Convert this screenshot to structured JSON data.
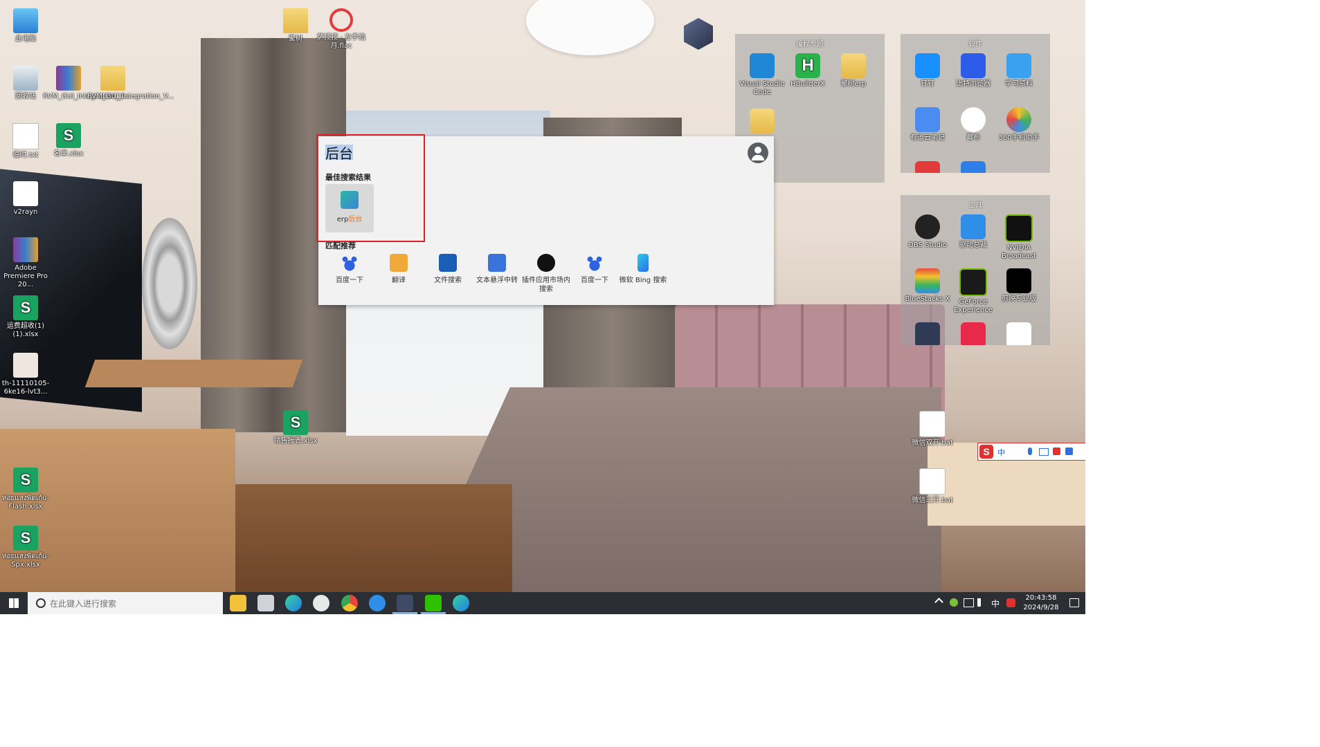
{
  "desktop_icons": [
    {
      "label": "此电脑"
    },
    {
      "label": "回收站"
    },
    {
      "label": "RVM_GUI_Integration_V..."
    },
    {
      "label": "RVM_GUI_Integration_V..."
    },
    {
      "label": "临时.txt"
    },
    {
      "label": "名单.xlsx"
    },
    {
      "label": "v2rayn"
    },
    {
      "label": "Adobe Premiere Pro 20..."
    },
    {
      "label": "运费超收(1)(1).xlsx"
    },
    {
      "label": "th-11110105-6ke16-lvt3..."
    },
    {
      "label": "ห่อยแสงพิดเก้u-Flash.xlsx"
    },
    {
      "label": "ห่อยแสงพิดเก้u-Spx.xlsx"
    },
    {
      "label": "聚树"
    },
    {
      "label": "萨顶顶 - 左手指月.flac"
    },
    {
      "label": "销售报表.xlsx"
    },
    {
      "label": "微信双开.bat"
    },
    {
      "label": "微信三开.bat"
    }
  ],
  "fences": {
    "programming": {
      "title": "编程专题",
      "items": [
        "Visual Studio Code",
        "HBuilderX",
        "聚树erp"
      ]
    },
    "software": {
      "title": "软件",
      "items": [
        "钉钉",
        "比特浏览器",
        "学习资料",
        "有道云笔记",
        "幕布",
        "360手机助手"
      ]
    },
    "tools": {
      "title": "工具",
      "items": [
        "OBS Studio",
        "驱动总裁",
        "NVIDIA Broadcast",
        "BlueStacks X",
        "GeForce Experience",
        "剪映专业版"
      ]
    }
  },
  "search_panel": {
    "query": "后台",
    "best_section": "最佳搜索结果",
    "best_result": {
      "prefix": "erp",
      "highlight": "后台"
    },
    "match_section": "匹配推荐",
    "recommendations": [
      "百度一下",
      "翻译",
      "文件搜索",
      "文本悬浮中转",
      "插件应用市场内搜索",
      "百度一下",
      "微软 Bing 搜索"
    ]
  },
  "ime_toolbar": {
    "label": "中"
  },
  "taskbar": {
    "search_placeholder": "在此键入进行搜索",
    "tray_lang": "中",
    "time": "20:43:58",
    "date": "2024/9/28"
  },
  "colors": {
    "accent_red": "#e02020",
    "highlight_orange": "#e8762c",
    "taskbar_bg": "#2b2e33"
  }
}
